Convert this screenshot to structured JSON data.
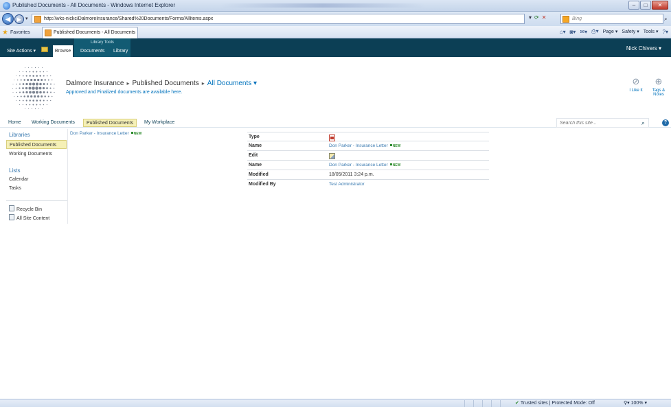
{
  "browser": {
    "window_title": "Published Documents - All Documents - Windows Internet Explorer",
    "window_buttons": {
      "minimize": "–",
      "maximize": "□",
      "close": "✕"
    },
    "url": "http://wks-nickc/DalmoreInsurance/Shared%20Documents/Forms/AllItems.aspx",
    "search_placeholder": "Bing",
    "favorites_label": "Favorites",
    "tab_title": "Published Documents - All Documents",
    "commands": {
      "page": "Page ▾",
      "safety": "Safety ▾",
      "tools": "Tools ▾"
    }
  },
  "ribbon": {
    "site_actions": "Site Actions ▾",
    "tools_group": "Library Tools",
    "tabs": [
      "Browse",
      "Documents",
      "Library"
    ],
    "user": "Nick Chivers ▾"
  },
  "header": {
    "breadcrumb": [
      "Dalmore Insurance",
      "Published Documents",
      "All Documents ▾"
    ],
    "description": "Approved and Finalized documents are available here.",
    "social": {
      "like": "I Like It",
      "tags": "Tags & Notes"
    }
  },
  "topnav": {
    "items": [
      "Home",
      "Working Documents",
      "Published Documents",
      "My Workplace"
    ],
    "selected": 2,
    "search_placeholder": "Search this site...",
    "help": "?"
  },
  "leftnav": {
    "libraries_header": "Libraries",
    "libraries": [
      "Published Documents",
      "Working Documents"
    ],
    "lists_header": "Lists",
    "lists": [
      "Calendar",
      "Tasks"
    ],
    "recycle_bin": "Recycle Bin",
    "all_site_content": "All Site Content"
  },
  "content": {
    "document_link": "Don Parker - Insurance Letter",
    "new_badge": "NEW",
    "properties": {
      "type_label": "Type",
      "name_label": "Name",
      "name_value": "Don Parker - Insurance Letter",
      "edit_label": "Edit",
      "name2_label": "Name",
      "name2_value": "Don Parker - Insurance Letter",
      "modified_label": "Modified",
      "modified_value": "18/05/2011 3:24 p.m.",
      "modified_by_label": "Modified By",
      "modified_by_value": "Test Administrator"
    }
  },
  "statusbar": {
    "zone": "Trusted sites | Protected Mode: Off",
    "zoom": "100%"
  },
  "colors": {
    "ribbon_bg": "#0c3f55",
    "link": "#3a7ab0",
    "selected_nav": "#f5f0b6"
  }
}
